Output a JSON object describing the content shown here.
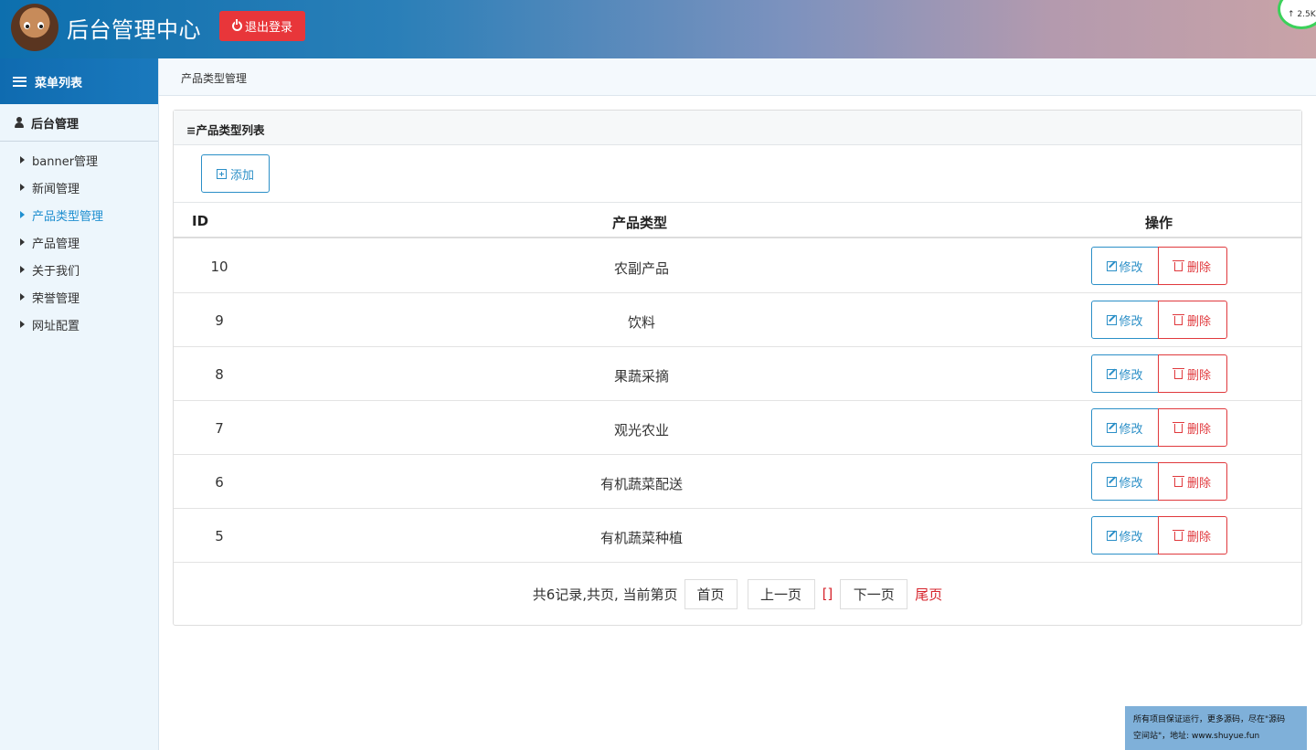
{
  "header": {
    "title": "后台管理中心",
    "logout_label": "退出登录",
    "speed_text": "↑ 2.5K"
  },
  "sidebar": {
    "menu_title": "菜单列表",
    "section_title": "后台管理",
    "items": [
      {
        "label": "banner管理",
        "active": false
      },
      {
        "label": "新闻管理",
        "active": false
      },
      {
        "label": "产品类型管理",
        "active": true
      },
      {
        "label": "产品管理",
        "active": false
      },
      {
        "label": "关于我们",
        "active": false
      },
      {
        "label": "荣誉管理",
        "active": false
      },
      {
        "label": "网址配置",
        "active": false
      }
    ]
  },
  "breadcrumb": "产品类型管理",
  "panel": {
    "title": "≡产品类型列表",
    "add_label": "添加",
    "columns": {
      "id": "ID",
      "name": "产品类型",
      "action": "操作"
    },
    "rows": [
      {
        "id": "10",
        "name": "农副产品"
      },
      {
        "id": "9",
        "name": "饮料"
      },
      {
        "id": "8",
        "name": "果蔬采摘"
      },
      {
        "id": "7",
        "name": "观光农业"
      },
      {
        "id": "6",
        "name": "有机蔬菜配送"
      },
      {
        "id": "5",
        "name": "有机蔬菜种植"
      }
    ],
    "edit_label": "修改",
    "delete_label": "删除"
  },
  "pagination": {
    "info": "共6记录,共页, 当前第页",
    "first": "首页",
    "prev": "上一页",
    "current": "[]",
    "next": "下一页",
    "last": "尾页"
  },
  "notice": {
    "line1": "所有项目保证运行，更多源码，尽在\"源码",
    "line2": "空间站\"，地址: www.shuyue.fun"
  },
  "colors": {
    "header_start": "#0d6fae",
    "accent_blue": "#2b8fc7",
    "danger_red": "#e0393d",
    "logout_red": "#e8363a"
  }
}
